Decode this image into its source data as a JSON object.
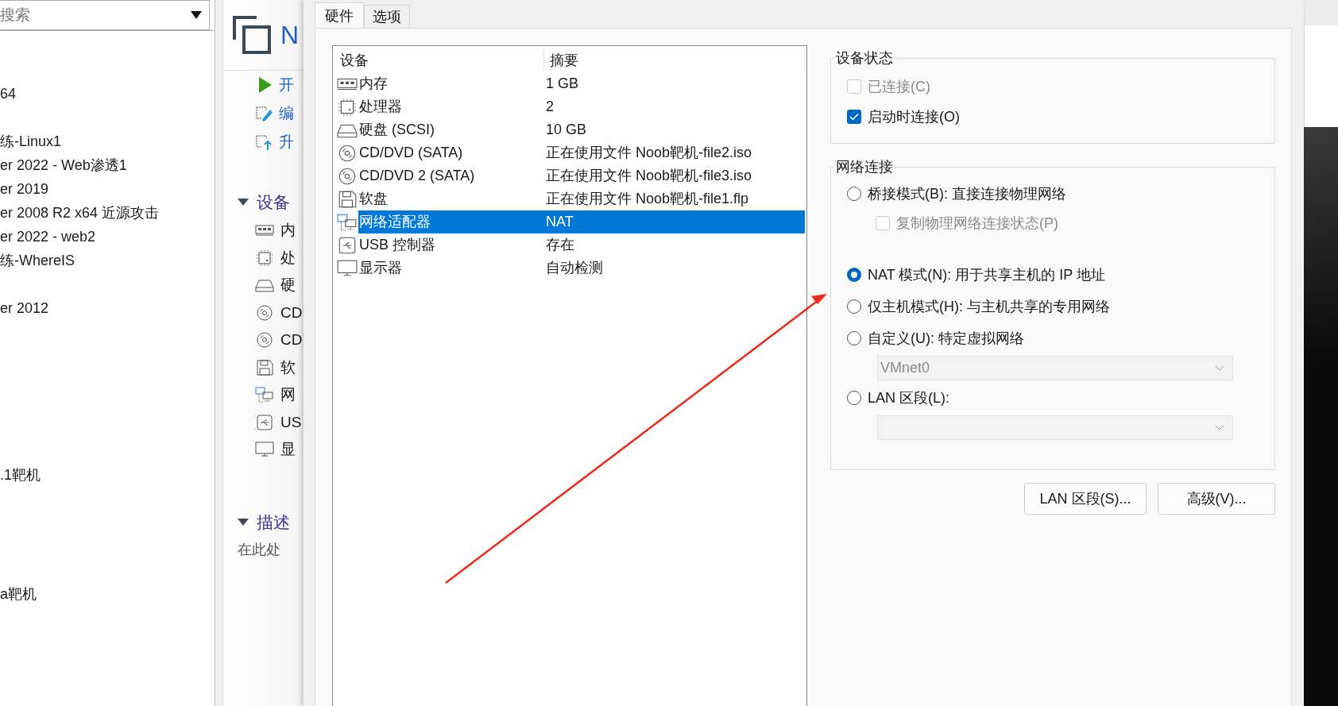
{
  "sidebar": {
    "search": {
      "placeholder": "搜索"
    },
    "items": [
      {
        "label": "64"
      },
      {
        "label": "练-Linux1"
      },
      {
        "label": "er 2022 - Web渗透1"
      },
      {
        "label": "er 2019"
      },
      {
        "label": "er 2008 R2 x64 近源攻击"
      },
      {
        "label": "er 2022 - web2"
      },
      {
        "label": "练-WhereIS"
      },
      {
        "label": "er 2012"
      },
      {
        "label": ".1靶机"
      },
      {
        "label": "a靶机"
      }
    ]
  },
  "vm_panel": {
    "title": "N",
    "actions": [
      {
        "label": "开",
        "kind": "play"
      },
      {
        "label": "编",
        "kind": "edit"
      },
      {
        "label": "升",
        "kind": "upgrade"
      }
    ],
    "devices_header": "设备",
    "devices": [
      {
        "label": "内",
        "kind": "memory"
      },
      {
        "label": "处",
        "kind": "cpu"
      },
      {
        "label": "硬",
        "kind": "disk"
      },
      {
        "label": "CD",
        "kind": "cd"
      },
      {
        "label": "CD",
        "kind": "cd"
      },
      {
        "label": "软",
        "kind": "floppy"
      },
      {
        "label": "网",
        "kind": "network"
      },
      {
        "label": "US",
        "kind": "usb"
      },
      {
        "label": "显",
        "kind": "display"
      }
    ],
    "description_header": "描述",
    "description": "在此处"
  },
  "dialog": {
    "tabs": [
      {
        "label": "硬件",
        "selected": true
      },
      {
        "label": "选项",
        "selected": false
      }
    ],
    "device_table": {
      "columns": [
        "设备",
        "摘要"
      ],
      "rows": [
        {
          "kind": "memory",
          "device": "内存",
          "summary": "1 GB",
          "selected": false
        },
        {
          "kind": "cpu",
          "device": "处理器",
          "summary": "2",
          "selected": false
        },
        {
          "kind": "disk",
          "device": "硬盘 (SCSI)",
          "summary": "10 GB",
          "selected": false
        },
        {
          "kind": "cd",
          "device": "CD/DVD (SATA)",
          "summary": "正在使用文件 Noob靶机-file2.iso",
          "selected": false
        },
        {
          "kind": "cd",
          "device": "CD/DVD 2 (SATA)",
          "summary": "正在使用文件 Noob靶机-file3.iso",
          "selected": false
        },
        {
          "kind": "floppy",
          "device": "软盘",
          "summary": "正在使用文件 Noob靶机-file1.flp",
          "selected": false
        },
        {
          "kind": "network",
          "device": "网络适配器",
          "summary": "NAT",
          "selected": true
        },
        {
          "kind": "usb",
          "device": "USB 控制器",
          "summary": "存在",
          "selected": false
        },
        {
          "kind": "display",
          "device": "显示器",
          "summary": "自动检测",
          "selected": false
        }
      ]
    },
    "device_status": {
      "title": "设备状态",
      "options": [
        {
          "label": "已连接(C)",
          "checked": false,
          "disabled": true
        },
        {
          "label": "启动时连接(O)",
          "checked": true,
          "disabled": false
        }
      ]
    },
    "network": {
      "title": "网络连接",
      "options": [
        {
          "kind": "radio",
          "label": "桥接模式(B): 直接连接物理网络",
          "selected": false
        },
        {
          "kind": "checkbox",
          "label": "复制物理网络连接状态(P)",
          "checked": false,
          "disabled": true
        },
        {
          "kind": "radio",
          "label": "NAT 模式(N): 用于共享主机的 IP 地址",
          "selected": true
        },
        {
          "kind": "radio",
          "label": "仅主机模式(H): 与主机共享的专用网络",
          "selected": false
        },
        {
          "kind": "radio",
          "label": "自定义(U): 特定虚拟网络",
          "selected": false
        },
        {
          "kind": "dropdown",
          "value": "VMnet0",
          "disabled": true
        },
        {
          "kind": "radio",
          "label": "LAN 区段(L):",
          "selected": false
        },
        {
          "kind": "dropdown",
          "disabled": true
        }
      ]
    },
    "buttons": [
      "LAN 区段(S)...",
      "高级(V)..."
    ]
  }
}
